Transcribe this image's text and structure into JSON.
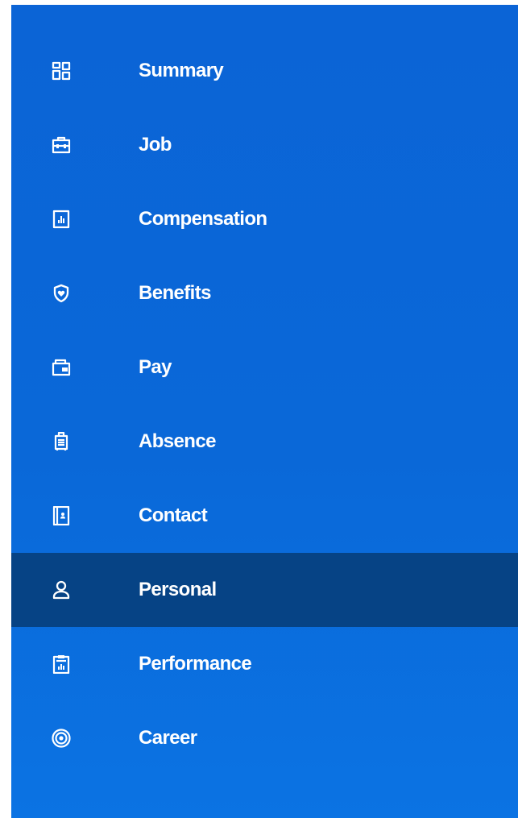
{
  "theme": {
    "sidebar_background": "#0b6ad9",
    "active_background": "#064385",
    "text_color": "#ffffff"
  },
  "nav": {
    "selected": "Personal",
    "items": [
      {
        "label": "Summary",
        "icon": "dashboard-grid-icon"
      },
      {
        "label": "Job",
        "icon": "briefcase-icon"
      },
      {
        "label": "Compensation",
        "icon": "bar-chart-document-icon"
      },
      {
        "label": "Benefits",
        "icon": "heart-shield-icon"
      },
      {
        "label": "Pay",
        "icon": "wallet-icon"
      },
      {
        "label": "Absence",
        "icon": "luggage-icon"
      },
      {
        "label": "Contact",
        "icon": "contact-book-icon"
      },
      {
        "label": "Personal",
        "icon": "person-icon"
      },
      {
        "label": "Performance",
        "icon": "clipboard-chart-icon"
      },
      {
        "label": "Career",
        "icon": "target-icon"
      }
    ]
  }
}
